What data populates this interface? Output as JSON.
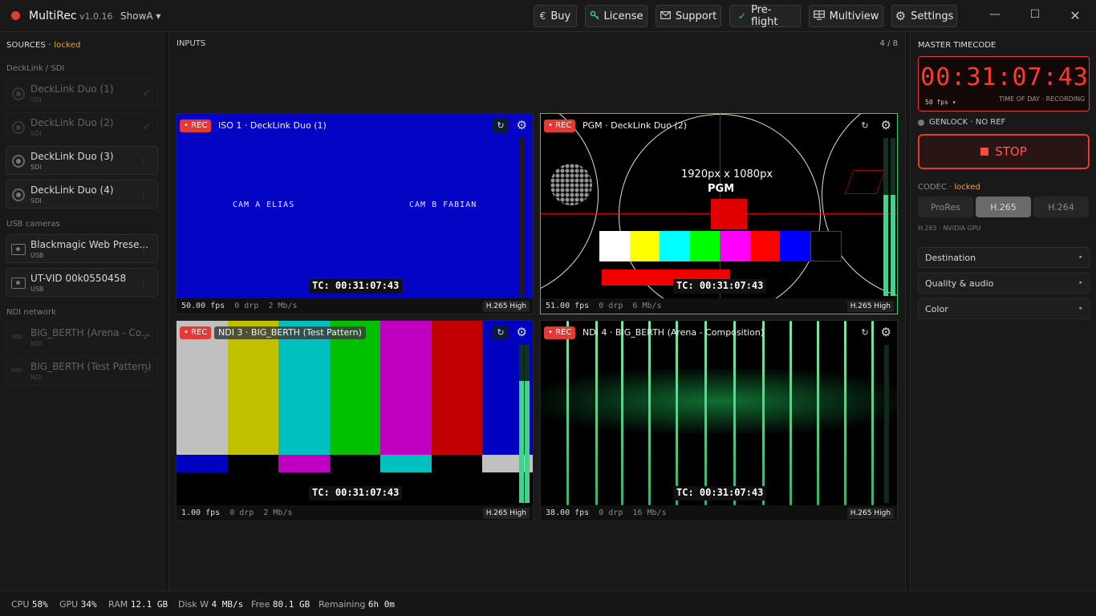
{
  "app": {
    "name": "MultiRec",
    "version": "v1.0.16",
    "show": "ShowA ▾"
  },
  "toolbar": {
    "buy": "Buy",
    "license": "License",
    "support": "Support",
    "preflight": "Pre-flight",
    "multiview": "Multiview",
    "settings": "Settings",
    "icons": {
      "buy": "€",
      "license": "key-icon",
      "support": "mail-icon",
      "preflight": "✓",
      "multiview": "monitor-icon",
      "settings": "gear-icon"
    }
  },
  "window": {
    "minimize": "—",
    "maximize": "☐",
    "close": "✕"
  },
  "sources": {
    "title": "SOURCES",
    "locked": "locked",
    "groups": {
      "sdi": "DeckLink / SDI",
      "usb": "USB cameras",
      "ndi": "NDI network"
    },
    "sdi": [
      {
        "name": "DeckLink Duo (1)",
        "sub": "SDI",
        "state": "✓",
        "enabled": false
      },
      {
        "name": "DeckLink Duo (2)",
        "sub": "SDI",
        "state": "✓",
        "enabled": false
      },
      {
        "name": "DeckLink Duo (3)",
        "sub": "SDI",
        "state": "⋮",
        "enabled": true
      },
      {
        "name": "DeckLink Duo (4)",
        "sub": "SDI",
        "state": "⋮",
        "enabled": true
      }
    ],
    "usb": [
      {
        "name": "Blackmagic Web Prese...",
        "sub": "USB",
        "state": "⋮",
        "enabled": true
      },
      {
        "name": "UT-VID 00k0550458",
        "sub": "USB",
        "state": "⋮",
        "enabled": true
      }
    ],
    "ndi": [
      {
        "name": "BIG_BERTH (Arena - Co...",
        "sub": "NDI",
        "state": "✓",
        "enabled": false
      },
      {
        "name": "BIG_BERTH (Test Pattern)",
        "sub": "NDI",
        "state": "✓",
        "enabled": false
      }
    ],
    "ndi_badge": "NDI"
  },
  "inputs": {
    "title": "INPUTS",
    "count": "4 / 8",
    "rec_label": "• REC",
    "refresh_icon": "↻",
    "gear_icon": "⚙",
    "tiles": [
      {
        "name": "ISO 1 · DeckLink Duo (1)",
        "tc": "TC: 00:31:07:43",
        "fps": "50.00 fps",
        "drp": "0 drp",
        "rate": "2 Mb/s",
        "codec": "H.265 High",
        "level": 0.0,
        "cam_a": "CAM A ELIAS",
        "cam_b": "CAM B FABIAN"
      },
      {
        "name": "PGM · DeckLink Duo (2)",
        "tc": "TC: 00:31:07:43",
        "fps": "51.00 fps",
        "drp": "0 drp",
        "rate": "6 Mb/s",
        "codec": "H.265 High",
        "level": 0.64,
        "res": "1920px x 1080px",
        "pgm": "PGM"
      },
      {
        "name": "NDI 3 · BIG_BERTH (Test Pattern)",
        "tc": "TC: 00:31:07:43",
        "fps": "1.00 fps",
        "drp": "0 drp",
        "rate": "2 Mb/s",
        "codec": "H.265 High",
        "level": 0.77
      },
      {
        "name": "NDI 4 · BIG_BERTH (Arena - Composition)",
        "tc": "TC: 00:31:07:43",
        "fps": "38.00 fps",
        "drp": "0 drp",
        "rate": "16 Mb/s",
        "codec": "H.265 High",
        "level": 0.0
      }
    ]
  },
  "master": {
    "title": "MASTER TIMECODE",
    "timecode": "00:31:07:43",
    "fps": "50 fps ▾",
    "sub": "TIME OF DAY · RECORDING",
    "genlock": "GENLOCK · NO REF",
    "stop": "STOP"
  },
  "codec": {
    "title": "CODEC",
    "locked": "locked",
    "options": [
      "ProRes",
      "H.265",
      "H.264"
    ],
    "selected": "H.265",
    "sub": "H.265 · NVIDIA GPU"
  },
  "accordions": [
    {
      "label": "Destination",
      "arrow": "▸"
    },
    {
      "label": "Quality & audio",
      "arrow": "▸"
    },
    {
      "label": "Color",
      "arrow": "▸"
    }
  ],
  "status": {
    "cpu_label": "CPU",
    "cpu": "58%",
    "gpu_label": "GPU",
    "gpu": "34%",
    "ram_label": "RAM",
    "ram": "12.1 GB",
    "disk_label": "Disk W",
    "disk": "4 MB/s",
    "free_label": "Free",
    "free": "80.1 GB",
    "remaining_label": "Remaining",
    "remaining": "6h 0m"
  },
  "colors": {
    "accent_red": "#e53935",
    "ok_green": "#29a56b",
    "locked_orange": "#e8a53a",
    "meter_green": "#3fd38b"
  }
}
